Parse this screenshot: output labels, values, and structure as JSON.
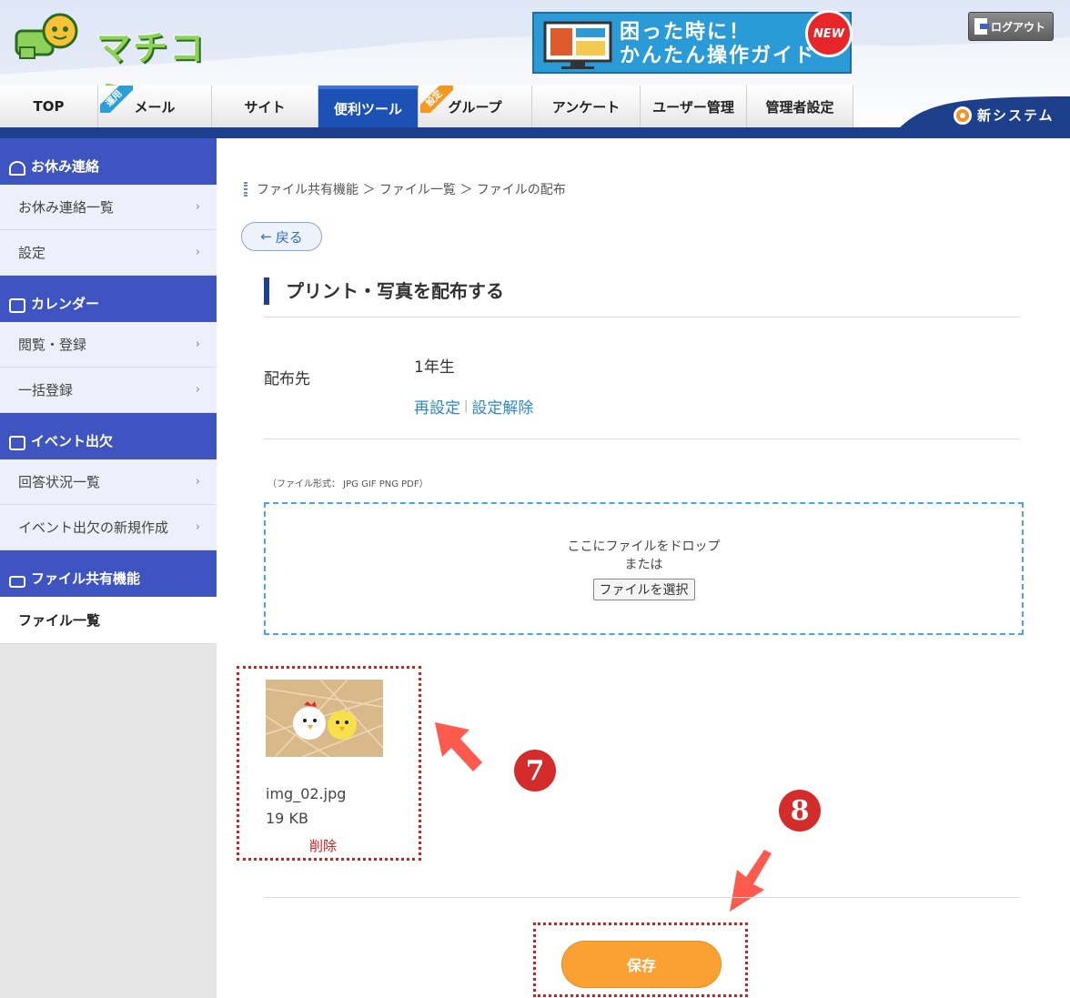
{
  "header": {
    "logo_text": "マチコミ",
    "guide_banner": {
      "line1": "困った時に！",
      "line2": "かんたん操作ガイド",
      "badge": "NEW"
    },
    "logout_label": "ログアウト",
    "new_system_label": "新システム"
  },
  "tabs": [
    {
      "label": "TOP",
      "ribbon": ""
    },
    {
      "label": "メール",
      "ribbon": "運用"
    },
    {
      "label": "サイト",
      "ribbon": ""
    },
    {
      "label": "便利ツール",
      "ribbon": "",
      "active": true
    },
    {
      "label": "グループ",
      "ribbon": "設定"
    },
    {
      "label": "アンケート",
      "ribbon": ""
    },
    {
      "label": "ユーザー管理",
      "ribbon": ""
    },
    {
      "label": "管理者設定",
      "ribbon": ""
    }
  ],
  "sidebar": {
    "sections": [
      {
        "title": "お休み連絡",
        "icon": "user-icon",
        "items": [
          "お休み連絡一覧",
          "設定"
        ]
      },
      {
        "title": "カレンダー",
        "icon": "calendar-icon",
        "items": [
          "閲覧・登録",
          "一括登録"
        ]
      },
      {
        "title": "イベント出欠",
        "icon": "calendar-check-icon",
        "items": [
          "回答状況一覧",
          "イベント出欠の新規作成"
        ]
      },
      {
        "title": "ファイル共有機能",
        "icon": "folder-icon",
        "items": [
          "ファイル一覧"
        ]
      }
    ]
  },
  "main": {
    "breadcrumb": "ファイル共有機能 ＞ ファイル一覧 ＞ ファイルの配布",
    "back_label": "戻る",
    "page_title": "プリント・写真を配布する",
    "distribution": {
      "label": "配布先",
      "value": "1年生",
      "reset_link": "再設定",
      "clear_link": "設定解除"
    },
    "file_format_note": "（ファイル形式： JPG GIF PNG PDF）",
    "dropzone": {
      "line1": "ここにファイルをドロップ",
      "line2": "または",
      "choose_button": "ファイルを選択"
    },
    "file": {
      "name": "img_02.jpg",
      "size": "19 KB",
      "delete_label": "削除"
    },
    "annotations": {
      "step7": "7",
      "step8": "8"
    },
    "save_label": "保存"
  }
}
